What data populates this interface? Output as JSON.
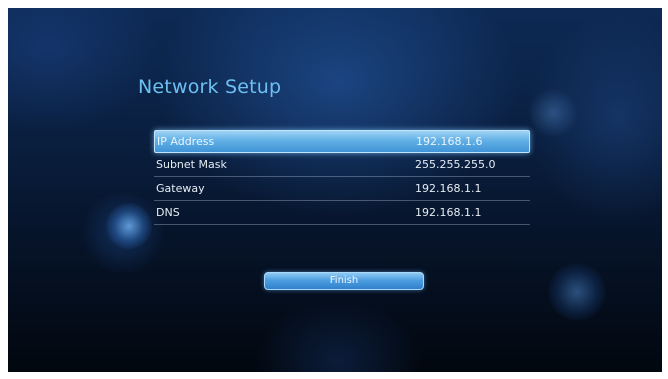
{
  "screen": {
    "title": "Network Setup"
  },
  "network": {
    "rows": [
      {
        "label": "IP Address",
        "value": "192.168.1.6",
        "selected": true
      },
      {
        "label": "Subnet Mask",
        "value": "255.255.255.0",
        "selected": false
      },
      {
        "label": "Gateway",
        "value": "192.168.1.1",
        "selected": false
      },
      {
        "label": "DNS",
        "value": "192.168.1.1",
        "selected": false
      }
    ]
  },
  "actions": {
    "finish_label": "Finish"
  },
  "colors": {
    "title": "#6cc0f2",
    "highlight": "#62b0e6",
    "background": "#0a1f40"
  }
}
